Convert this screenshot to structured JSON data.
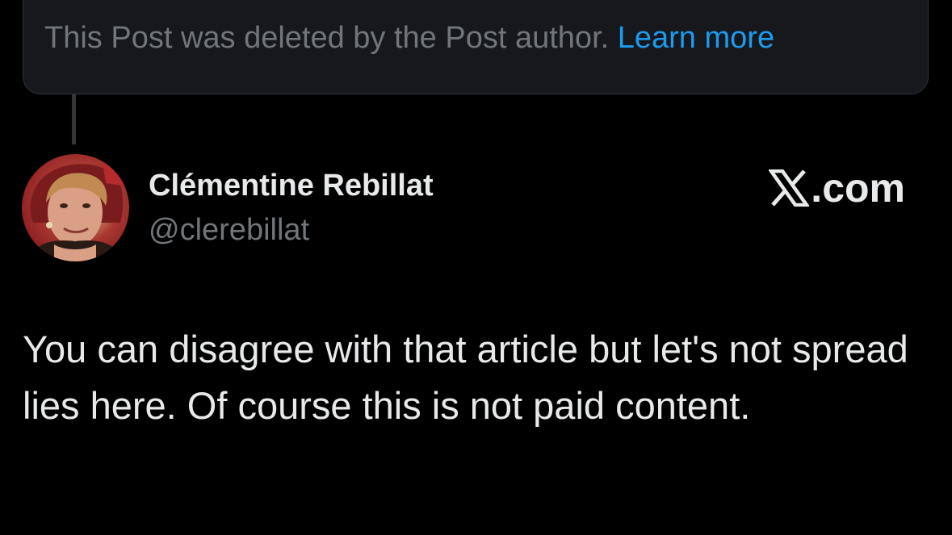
{
  "deleted_notice": {
    "text": "This Post was deleted by the Post author.",
    "link": "Learn more"
  },
  "author": {
    "display_name": "Clémentine Rebillat",
    "handle": "@clerebillat",
    "avatar_icon": "user-avatar-photo"
  },
  "brand": {
    "icon": "x-logo-icon",
    "label": ".com"
  },
  "post": {
    "text": "You can disagree with that article but let's not spread lies here. Of course this is not paid content."
  },
  "colors": {
    "background": "#000000",
    "notice_bg": "#16181c",
    "muted_text": "#71767b",
    "link": "#1d9bf0",
    "primary_text": "#e7e9ea"
  }
}
